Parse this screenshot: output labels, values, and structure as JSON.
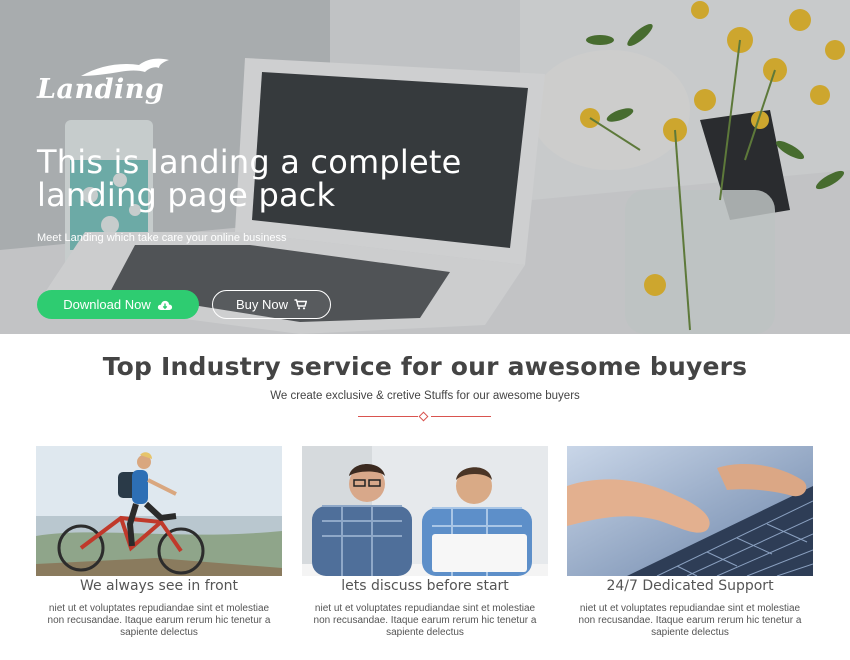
{
  "brand": {
    "logo_text": "Landing"
  },
  "hero": {
    "title": "This is landing a complete landing page pack",
    "subtitle": "Meet Landing which take care your online business",
    "download_label": "Download Now",
    "buy_label": "Buy Now",
    "icons": {
      "download": "cloud-download-icon",
      "buy": "cart-icon"
    },
    "colors": {
      "download_button": "#2ecc71",
      "text": "#ffffff"
    }
  },
  "services": {
    "title": "Top Industry service for our awesome buyers",
    "subtitle": "We create exclusive & cretive Stuffs for our awesome buyers",
    "divider_color": "#d9534f",
    "cards": [
      {
        "title": "We always see in front",
        "text": "niet ut et voluptates repudiandae sint et molestiae non recusandae. Itaque earum rerum hic tenetur a sapiente delectus"
      },
      {
        "title": "lets discuss before start",
        "text": "niet ut et voluptates repudiandae sint et molestiae non recusandae. Itaque earum rerum hic tenetur a sapiente delectus"
      },
      {
        "title": "24/7 Dedicated Support",
        "text": "niet ut et voluptates repudiandae sint et molestiae non recusandae. Itaque earum rerum hic tenetur a sapiente delectus"
      }
    ]
  }
}
